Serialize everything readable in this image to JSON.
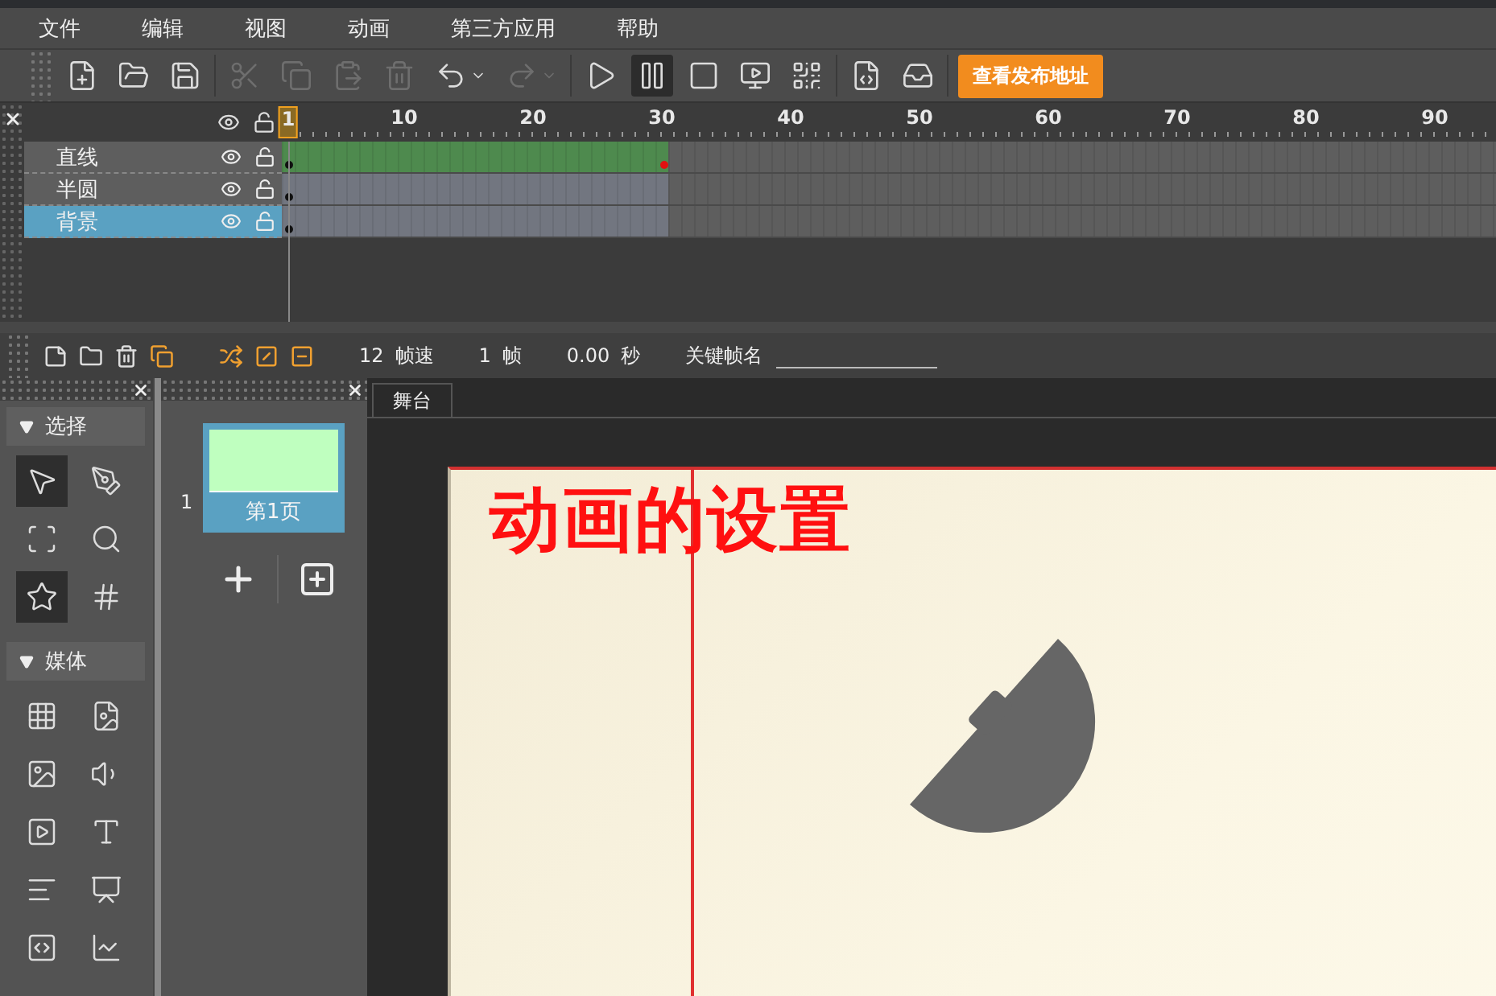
{
  "menu": [
    "文件",
    "编辑",
    "视图",
    "动画",
    "第三方应用",
    "帮助"
  ],
  "toolbar": {
    "groups": [
      [
        {
          "kind": "new",
          "disabled": false,
          "selected": false
        },
        {
          "kind": "open",
          "disabled": false,
          "selected": false
        },
        {
          "kind": "save",
          "disabled": false,
          "selected": false
        }
      ],
      [
        {
          "kind": "cut",
          "disabled": true,
          "selected": false
        },
        {
          "kind": "copy",
          "disabled": true,
          "selected": false
        },
        {
          "kind": "paste",
          "disabled": true,
          "selected": false
        },
        {
          "kind": "delete",
          "disabled": true,
          "selected": false
        },
        {
          "kind": "undo",
          "disabled": false,
          "selected": false,
          "has_menu": true
        },
        {
          "kind": "redo",
          "disabled": true,
          "selected": false,
          "has_menu": true
        }
      ],
      [
        {
          "kind": "play",
          "disabled": false,
          "selected": false
        },
        {
          "kind": "pause",
          "disabled": false,
          "selected": true
        },
        {
          "kind": "stop",
          "disabled": false,
          "selected": false
        },
        {
          "kind": "preview",
          "disabled": false,
          "selected": false
        },
        {
          "kind": "qrcode",
          "disabled": false,
          "selected": false
        }
      ],
      [
        {
          "kind": "js",
          "disabled": false,
          "selected": false
        },
        {
          "kind": "tray",
          "disabled": false,
          "selected": false
        }
      ]
    ],
    "publish_button": "查看发布地址"
  },
  "timeline": {
    "ruler": [
      {
        "label": "1",
        "selected": true
      },
      {
        "label": "10",
        "selected": false
      },
      {
        "label": "20",
        "selected": false
      },
      {
        "label": "30",
        "selected": false
      },
      {
        "label": "40",
        "selected": false
      },
      {
        "label": "50",
        "selected": false
      },
      {
        "label": "60",
        "selected": false
      },
      {
        "label": "70",
        "selected": false
      },
      {
        "label": "80",
        "selected": false
      },
      {
        "label": "90",
        "selected": false
      }
    ],
    "layers": [
      {
        "name": "直线",
        "selected": false,
        "tween": true
      },
      {
        "name": "半圆",
        "selected": false,
        "tween": false
      },
      {
        "name": "背景",
        "selected": true,
        "tween": false
      }
    ],
    "footer": {
      "fps": "12",
      "fps_label": "帧速",
      "frame": "1",
      "frame_label": "帧",
      "time": "0.00",
      "time_label": "秒",
      "keyframe_name_label": "关键帧名"
    }
  },
  "tools": [
    {
      "title": "选择",
      "expanded": true,
      "items": [
        {
          "kind": "arrow",
          "selected": true
        },
        {
          "kind": "path",
          "selected": false
        },
        {
          "kind": "transform",
          "selected": false
        },
        {
          "kind": "zoom",
          "selected": false
        },
        {
          "kind": "star",
          "selected": true
        },
        {
          "kind": "guide",
          "selected": false
        }
      ]
    },
    {
      "title": "媒体",
      "expanded": true,
      "items": [
        {
          "kind": "grid",
          "selected": false
        },
        {
          "kind": "ps",
          "selected": false
        },
        {
          "kind": "image",
          "selected": false
        },
        {
          "kind": "sound",
          "selected": false
        },
        {
          "kind": "video",
          "selected": false
        },
        {
          "kind": "text",
          "selected": false
        },
        {
          "kind": "paragraph",
          "selected": false
        },
        {
          "kind": "board",
          "selected": false
        },
        {
          "kind": "code",
          "selected": false
        },
        {
          "kind": "chart",
          "selected": false
        }
      ]
    }
  ],
  "pages": [
    {
      "number": "1",
      "label": "第1页",
      "selected": true
    }
  ],
  "stage": {
    "tab": "舞台",
    "title": "动画的设置"
  }
}
